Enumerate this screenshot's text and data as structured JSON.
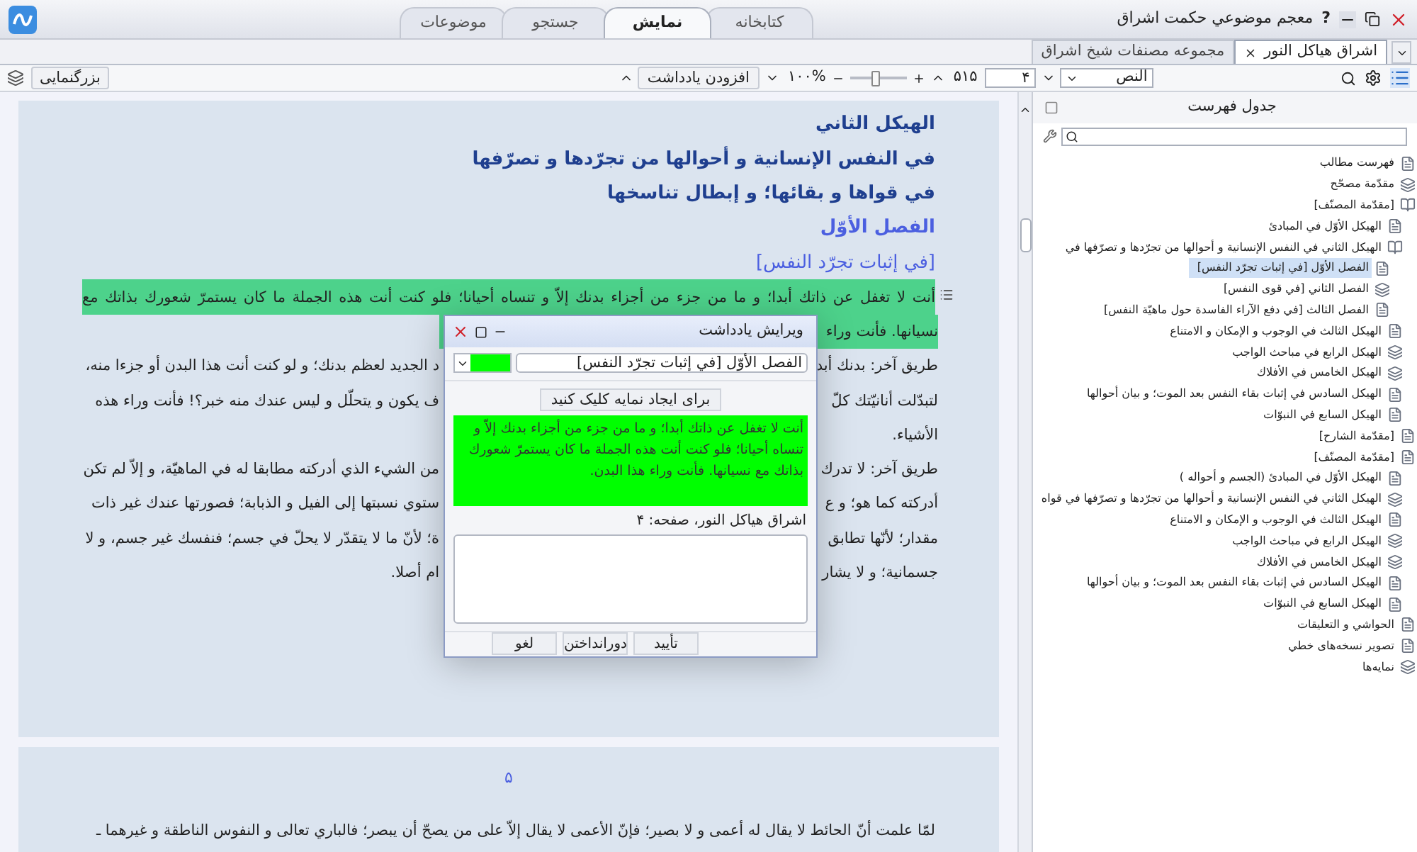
{
  "window": {
    "title": "معجم موضوعي حکمت اشراق",
    "help": "?"
  },
  "main_tabs": [
    {
      "label": "کتابخانه",
      "selected": false
    },
    {
      "label": "نمایش",
      "selected": true
    },
    {
      "label": "جستجو",
      "selected": false
    },
    {
      "label": "موضوعات",
      "selected": false
    }
  ],
  "doc_tabs": [
    {
      "label": "اشراق هياكل النور",
      "selected": true,
      "closable": true
    },
    {
      "label": "مجموعه مصنفات شيخ اشراق",
      "selected": false,
      "closable": false
    }
  ],
  "toolbar": {
    "view_select": "النص",
    "page": "۴",
    "page_count": "۵۱۵",
    "zoom": "۱۰۰%",
    "zoom_slider": {
      "level": 0.45
    },
    "add_note": "افزودن یادداشت",
    "magnify": "بزرگنمایی"
  },
  "document": {
    "headings": [
      {
        "text": "الهيكل الثاني",
        "kind": "title"
      },
      {
        "text": "في النفس الإنسانية و أحوالها من تجرّدها و تصرّفها",
        "kind": "title"
      },
      {
        "text": "في قواها و بقائها؛ و إبطال تناسخها",
        "kind": "title"
      },
      {
        "text": "الفصل الأوّل",
        "kind": "chapter"
      },
      {
        "text": "[في إثبات تجرّد النفس]",
        "kind": "subtitle"
      }
    ],
    "lines": [
      {
        "kind": "noted",
        "start": "أنت لا تغفل عن ذاتك أبدا؛ و ما من جزء من أجزاء بدنك إلاّ و تنساه أحيانا؛ فلو كنت أنت هذه الجملة ما كان يستمرّ شعورك بذاتك مع",
        "highlighted": true
      },
      {
        "kind": "split",
        "start": "نسيانها. فأنت وراء",
        "highlighted": true
      },
      {
        "kind": "split",
        "start": "طريق آخر: بدنك أبد",
        "end": "د الجديد لعظم بدنك؛ و لو كنت أنت هذا البدن أو جزءا منه،",
        "highlighted": false
      },
      {
        "kind": "split",
        "start": "لتبدّلت أنانيّتك كلّ",
        "end": "ف يكون و يتحلّل و ليس عندك منه خبر؟! فأنت وراء هذه",
        "highlighted": false
      },
      {
        "kind": "split",
        "start": "الأشياء.",
        "highlighted": false
      },
      {
        "kind": "split",
        "start": "طريق آخر: لا تدرك",
        "end": "من الشيء الذي أدركته مطابقا له في الماهيّة، و إلاّ لم تكن",
        "highlighted": false
      },
      {
        "kind": "split",
        "start": "أدركته كما هو؛ و ع",
        "end": "ستوي نسبتها إلى الفيل و الذبابة؛ فصورتها عندك غير ذات",
        "highlighted": false
      },
      {
        "kind": "split",
        "start": "مقدار؛ لأنّها تطابق",
        "end": "ة؛ لأنّ ما لا يتقدّر لا يحلّ في جسم؛ فنفسك غير جسم، و لا",
        "highlighted": false
      },
      {
        "kind": "split",
        "start": "جسمانية؛ و لا يشار",
        "end": "ام أصلا.",
        "highlighted": false
      }
    ],
    "next_page": {
      "number": "۵",
      "text": "لمّا علمت أنّ الحائط لا يقال له أعمى و لا بصير؛ فإنّ الأعمى لا يقال إلاّ على من يصحّ أن يبصر؛ فالباري تعالى و النفوس الناطقة و غيرهما ـ"
    }
  },
  "toc": {
    "title": "جدول فهرست",
    "items": [
      {
        "label": "فهرست مطالب",
        "kind": "page",
        "selected": false
      },
      {
        "label": "مقدّمة مصحّح",
        "kind": "stack",
        "selected": false
      },
      {
        "label": "[مقدّمة المصنّف]",
        "kind": "book",
        "selected": false,
        "children": [
          {
            "label": "الهيكل الأوّل في المبادئ",
            "kind": "page",
            "selected": false
          },
          {
            "label": "الهيكل الثاني في النفس الإنسانية و أحوالها من تجرّدها و تصرّفها في",
            "kind": "book",
            "selected": false,
            "children": [
              {
                "label": "الفصل الأوّل [في إثبات تجرّد النفس]",
                "kind": "page",
                "selected": true
              },
              {
                "label": "الفصل الثاني [في قوى النفس]",
                "kind": "stack",
                "selected": false
              },
              {
                "label": "الفصل الثالث [في دفع الآراء الفاسدة حول ماهيّة النفس]",
                "kind": "page",
                "selected": false
              }
            ]
          },
          {
            "label": "الهيكل الثالث في الوجوب و الإمكان و الامتناع",
            "kind": "page",
            "selected": false
          },
          {
            "label": "الهيكل الرابع في مباحث الواجب",
            "kind": "stack",
            "selected": false
          },
          {
            "label": "الهيكل الخامس في الأفلاك",
            "kind": "stack",
            "selected": false
          },
          {
            "label": "الهيكل السادس في إثبات بقاء النفس بعد الموت؛ و بيان أحوالها",
            "kind": "page",
            "selected": false
          },
          {
            "label": "الهيكل السابع في النبوّات",
            "kind": "page",
            "selected": false
          }
        ]
      },
      {
        "label": "[مقدّمة الشارح]",
        "kind": "page",
        "selected": false
      },
      {
        "label": "[مقدّمة المصنّف]",
        "kind": "page",
        "selected": false,
        "children": [
          {
            "label": "الهيكل الأوّل في المبادئ (الجسم و أحواله )",
            "kind": "page",
            "selected": false
          },
          {
            "label": "الهيكل الثاني في النفس الإنسانية و أحوالها من تجرّدها و تصرّفها في قواه",
            "kind": "stack",
            "selected": false
          },
          {
            "label": "الهيكل الثالث في الوجوب و الإمكان و الامتناع",
            "kind": "page",
            "selected": false
          },
          {
            "label": "الهيكل الرابع في مباحث الواجب",
            "kind": "stack",
            "selected": false
          },
          {
            "label": "الهيكل الخامس في الأفلاك",
            "kind": "stack",
            "selected": false
          },
          {
            "label": "الهيكل السادس في إثبات بقاء النفس بعد الموت؛ و بيان أحوالها",
            "kind": "page",
            "selected": false
          },
          {
            "label": "الهيكل السابع في النبوّات",
            "kind": "page",
            "selected": false
          }
        ]
      },
      {
        "label": "الحواشي و التعليقات",
        "kind": "page",
        "selected": false
      },
      {
        "label": "تصوير نسخه‌های خطي",
        "kind": "page",
        "selected": false
      },
      {
        "label": "نمايه‌ها",
        "kind": "stack",
        "selected": false
      }
    ]
  },
  "note_dialog": {
    "title": "ویرایش یادداشت",
    "heading": "الفصل الأوّل [في إثبات تجرّد النفس]",
    "color": "#00ff00",
    "index_button": "برای ایجاد نمایه کلیک کنید",
    "quote": "أنت لا تغفل عن ذاتك أبدا؛ و ما من جزء من أجزاء بدنك إلاّ و تنساه أحيانا؛ فلو كنت أنت هذه الجملة ما كان يستمرّ شعورك بذاتك مع نسيانها. فأنت وراء هذا البدن.",
    "source": "اشراق هياكل النور، صفحه: ۴",
    "buttons": [
      "تأیید",
      "دورانداختن",
      "لغو"
    ]
  }
}
